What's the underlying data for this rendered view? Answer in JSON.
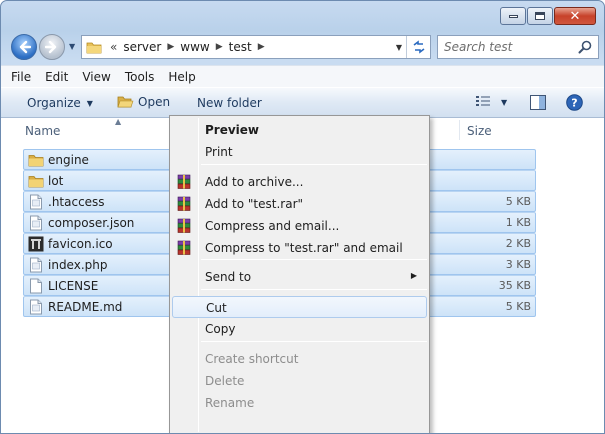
{
  "window": {
    "controls": [
      "minimize-icon",
      "maximize-icon",
      "close-icon"
    ]
  },
  "address": {
    "overflow": "«",
    "path": [
      "server",
      "www",
      "test"
    ]
  },
  "search": {
    "placeholder": "Search test"
  },
  "menubar": {
    "items": [
      "File",
      "Edit",
      "View",
      "Tools",
      "Help"
    ]
  },
  "toolbar": {
    "organize": "Organize",
    "open": "Open",
    "new_folder": "New folder"
  },
  "columns": {
    "name": "Name",
    "size": "Size"
  },
  "files": [
    {
      "name": "engine",
      "size": "",
      "icon": "folder-icon"
    },
    {
      "name": "lot",
      "size": "",
      "icon": "folder-icon"
    },
    {
      "name": ".htaccess",
      "size": "5 KB",
      "icon": "file-icon"
    },
    {
      "name": "composer.json",
      "size": "1 KB",
      "icon": "file-icon"
    },
    {
      "name": "favicon.ico",
      "size": "2 KB",
      "icon": "favicon-icon"
    },
    {
      "name": "index.php",
      "size": "3 KB",
      "icon": "file-icon"
    },
    {
      "name": "LICENSE",
      "size": "35 KB",
      "icon": "blank-file-icon"
    },
    {
      "name": "README.md",
      "size": "5 KB",
      "icon": "file-icon"
    }
  ],
  "context_menu": {
    "items": [
      {
        "label": "Preview",
        "bold": true
      },
      {
        "label": "Print"
      },
      {
        "label": "Add to archive...",
        "icon": "winrar-icon"
      },
      {
        "label": "Add to \"test.rar\"",
        "icon": "winrar-icon"
      },
      {
        "label": "Compress and email...",
        "icon": "winrar-icon"
      },
      {
        "label": "Compress to \"test.rar\" and email",
        "icon": "winrar-icon"
      },
      {
        "label": "Send to",
        "submenu": true
      },
      {
        "label": "Cut",
        "hover": true
      },
      {
        "label": "Copy"
      },
      {
        "label": "Create shortcut",
        "disabled": true
      },
      {
        "label": "Delete",
        "disabled": true
      },
      {
        "label": "Rename",
        "disabled": true
      }
    ]
  },
  "colors": {
    "selection": "#cde3f8",
    "accent": "#2c6ec3",
    "close": "#c7422a"
  }
}
